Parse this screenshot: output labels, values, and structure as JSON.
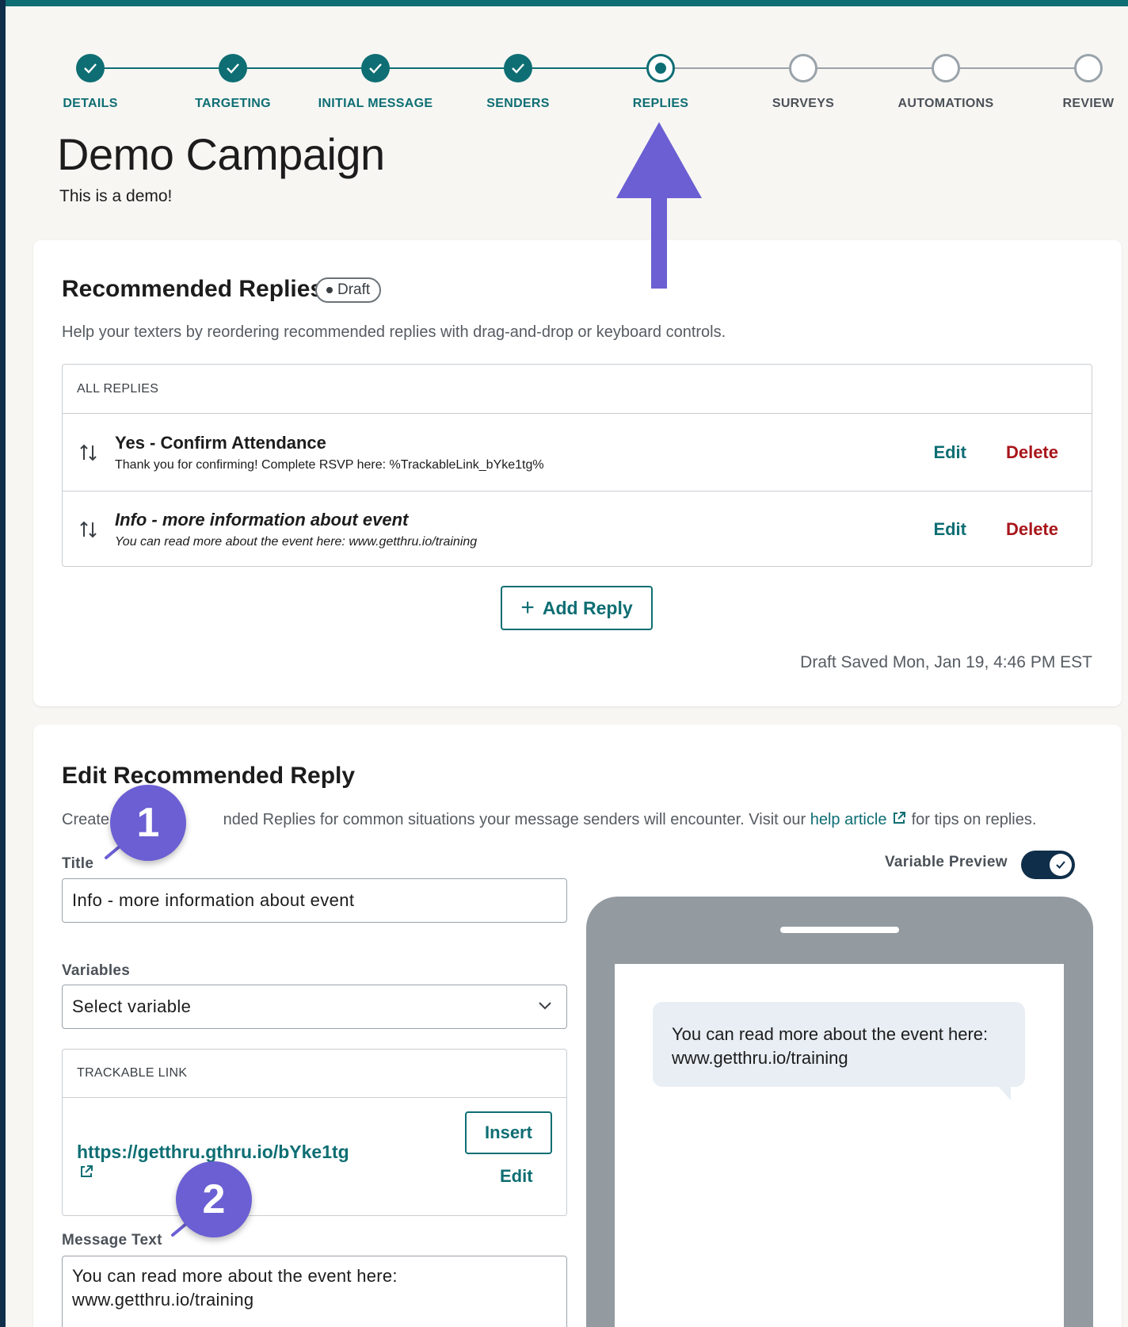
{
  "stepper": {
    "steps": [
      {
        "label": "DETAILS",
        "status": "done"
      },
      {
        "label": "TARGETING",
        "status": "done"
      },
      {
        "label": "INITIAL MESSAGE",
        "status": "done"
      },
      {
        "label": "SENDERS",
        "status": "done"
      },
      {
        "label": "REPLIES",
        "status": "current"
      },
      {
        "label": "SURVEYS",
        "status": "todo"
      },
      {
        "label": "AUTOMATIONS",
        "status": "todo"
      },
      {
        "label": "REVIEW",
        "status": "todo"
      }
    ]
  },
  "page": {
    "title": "Demo Campaign",
    "subtitle": "This is a demo!"
  },
  "recommended": {
    "title": "Recommended Replies",
    "badge": "Draft",
    "description": "Help your texters by reordering recommended replies with drag-and-drop or keyboard controls.",
    "table_header": "ALL REPLIES",
    "rows": [
      {
        "title": "Yes - Confirm Attendance",
        "text": "Thank you for confirming! Complete RSVP here: %TrackableLink_bYke1tg%",
        "edit": "Edit",
        "delete": "Delete"
      },
      {
        "title": "Info - more information about event",
        "text": "You can read more about the event here: www.getthru.io/training",
        "edit": "Edit",
        "delete": "Delete"
      }
    ],
    "add_button": "Add Reply",
    "draft_saved": "Draft Saved Mon, Jan 19, 4:46 PM EST"
  },
  "edit": {
    "title": "Edit Recommended Reply",
    "desc_start": "Create",
    "desc_mid": "nded Replies for common situations your message senders will encounter. Visit our",
    "help_link": "help article",
    "desc_end": "for tips on replies.",
    "title_label": "Title",
    "title_value": "Info - more information about event",
    "variables_label": "Variables",
    "variables_value": "Select variable",
    "trackable_header": "TRACKABLE LINK",
    "trackable_url": "https://getthru.gthru.io/bYke1tg",
    "insert": "Insert",
    "trackable_edit": "Edit",
    "message_label": "Message Text",
    "message_value": "You can read more about the event here:\nwww.getthru.io/training",
    "variable_preview_label": "Variable Preview",
    "variable_preview_on": true
  },
  "preview": {
    "bubble_text": "You can read more about the event here:\nwww.getthru.io/training"
  },
  "annotations": {
    "callout_1": "1",
    "callout_2": "2"
  },
  "colors": {
    "accent": "#0e6e73",
    "danger": "#a8151b",
    "annotation": "#6b5fd3",
    "navy": "#0f2e4a"
  }
}
